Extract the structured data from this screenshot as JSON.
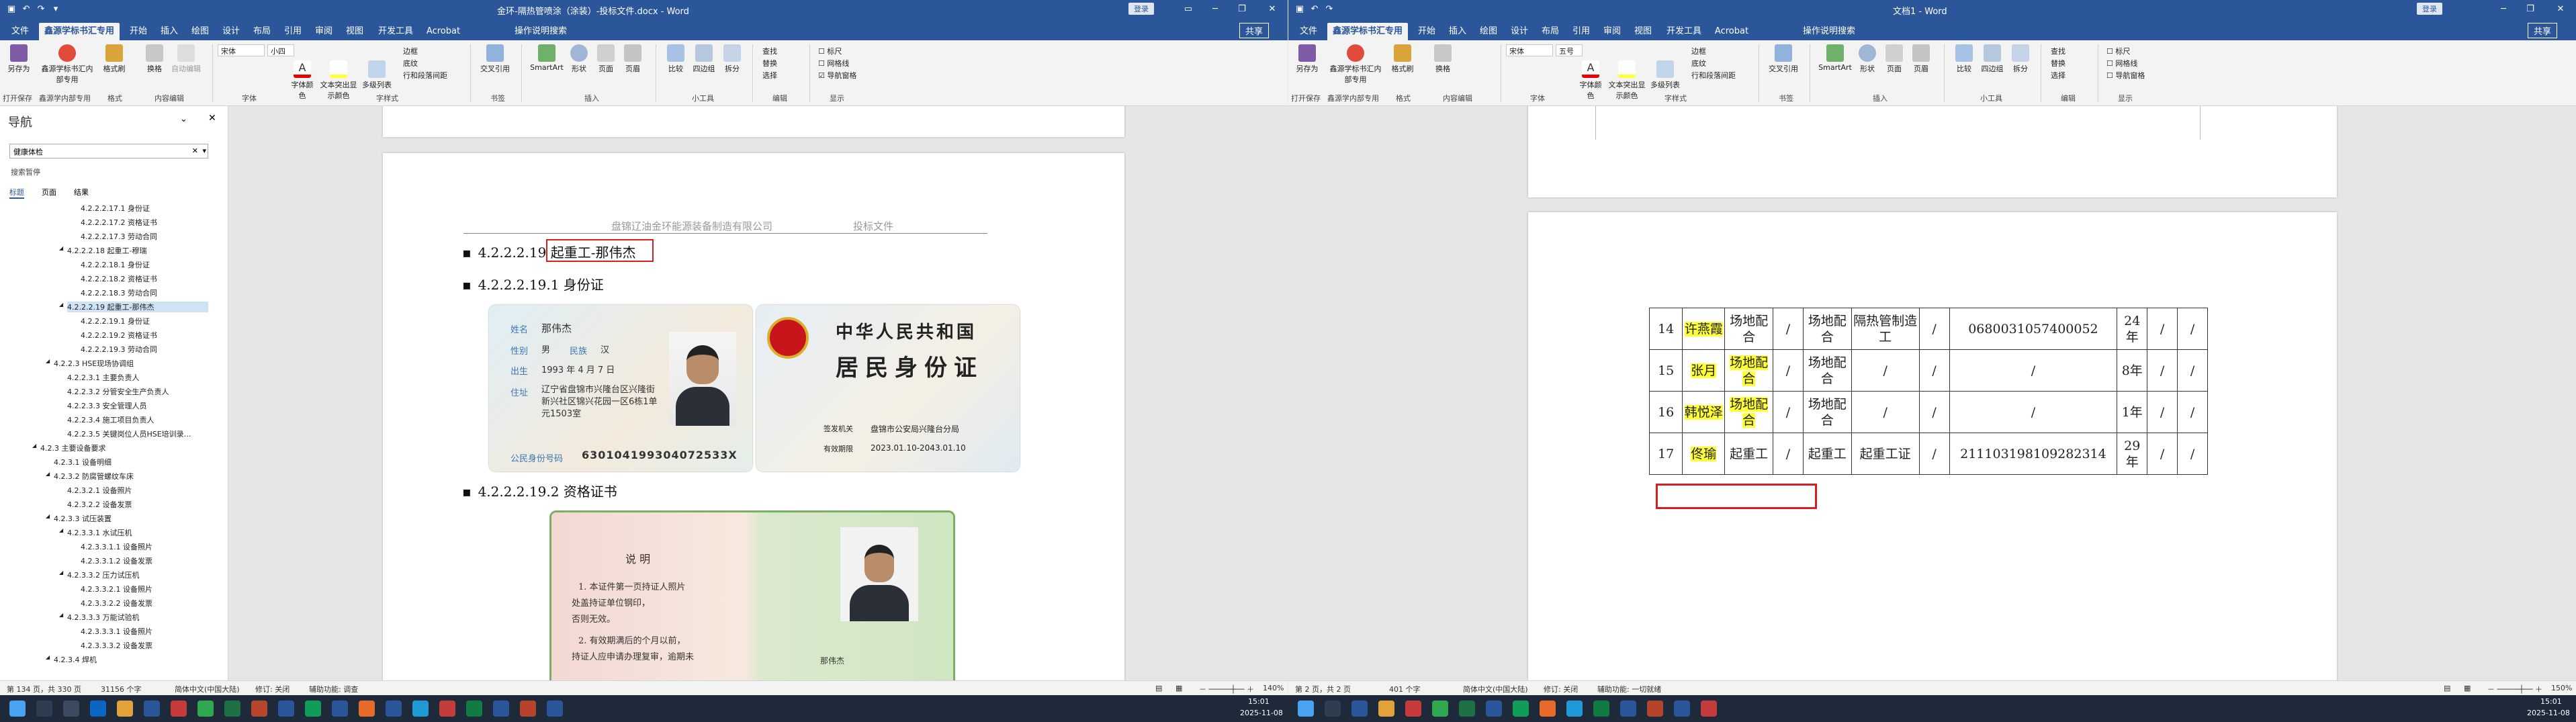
{
  "left": {
    "title": "金环-隔热管喷涂（涂装）-投标文件.docx - Word",
    "login": "登录",
    "share": "共享",
    "tabs": [
      "文件",
      "鑫源学标书汇专用",
      "开始",
      "插入",
      "绘图",
      "设计",
      "布局",
      "引用",
      "审阅",
      "视图",
      "开发工具",
      "Acrobat",
      "操作说明搜索"
    ],
    "ribbon": {
      "btn_save_as": "另存为",
      "btn_xyx": "鑫源学标书汇内部专用",
      "btn_format": "格式刷",
      "btn_change": "换格",
      "btn_auto": "自动编辑",
      "font_name": "宋体",
      "font_size": "小四",
      "btn_font_color": "字体颜色",
      "btn_text_color": "文本突出显示颜色",
      "btn_multi": "多级列表",
      "border": "边框",
      "shading": "底纹",
      "indent": "行和段落间距",
      "btn_cross": "交叉引用",
      "btn_smartart": "SmartArt",
      "btn_shape": "形状",
      "btn_page": "页面",
      "btn_header": "页眉",
      "btn_compare": "比较",
      "btn_four": "四边组",
      "btn_split": "拆分",
      "find": "查找",
      "replace": "替换",
      "select": "选择",
      "ruler": "标尺",
      "gridlines": "网格线",
      "navpane": "导航窗格",
      "groups": [
        "打开保存",
        "鑫源学内部专用",
        "格式",
        "内容编辑",
        "字体",
        "字样式",
        "书签",
        "插入",
        "小工具",
        "编辑",
        "显示"
      ]
    },
    "nav": {
      "title": "导航",
      "search": "健康体检",
      "results": "搜索暂停",
      "tabs": [
        "标题",
        "页面",
        "结果"
      ],
      "items": [
        "4.2.2.2.17.1 身份证",
        "4.2.2.2.17.2 资格证书",
        "4.2.2.2.17.3 劳动合同",
        "4.2.2.2.18 起重工-穆瑞",
        "4.2.2.2.18.1 身份证",
        "4.2.2.2.18.2 资格证书",
        "4.2.2.2.18.3 劳动合同",
        "4.2.2.2.19 起重工-那伟杰",
        "4.2.2.2.19.1 身份证",
        "4.2.2.2.19.2 资格证书",
        "4.2.2.2.19.3 劳动合同",
        "4.2.2.3 HSE现场协调组",
        "4.2.2.3.1 主要负责人",
        "4.2.2.3.2 分管安全生产负责人",
        "4.2.2.3.3 安全管理人员",
        "4.2.2.3.4 施工项目负责人",
        "4.2.2.3.5 关键岗位人员HSE培训录…",
        "4.2.3 主要设备要求",
        "4.2.3.1 设备明细",
        "4.2.3.2 防腐管螺纹车床",
        "4.2.3.2.1 设备照片",
        "4.2.3.2.2 设备发票",
        "4.2.3.3 试压装置",
        "4.2.3.3.1 水试压机",
        "4.2.3.3.1.1 设备照片",
        "4.2.3.3.1.2 设备发票",
        "4.2.3.3.2 压力试压机",
        "4.2.3.3.2.1 设备照片",
        "4.2.3.3.2.2 设备发票",
        "4.2.3.3.3 万能试验机",
        "4.2.3.3.3.1 设备照片",
        "4.2.3.3.3.2 设备发票",
        "4.2.3.4 焊机"
      ]
    },
    "doc": {
      "header_company": "盘锦辽油金环能源装备制造有限公司",
      "header_right": "投标文件",
      "h1": "4.2.2.2.19 起重工-那伟杰",
      "h2": "4.2.2.2.19.1 身份证",
      "h3": "4.2.2.2.19.2 资格证书",
      "id_front": {
        "name_label": "姓名",
        "name": "那伟杰",
        "sex_label": "性别",
        "sex": "男",
        "eth_label": "民族",
        "eth": "汉",
        "birth_label": "出生",
        "birth": "1993 年 4 月 7 日",
        "addr_label": "住址",
        "addr": "辽宁省盘锦市兴隆台区兴隆街新兴社区锦兴花园一区6栋1单元1503室",
        "id_label": "公民身份号码",
        "id": "630104199304072533X"
      },
      "id_back": {
        "title1": "中华人民共和国",
        "title2": "居民身份证",
        "authority_label": "签发机关",
        "authority": "盘锦市公安局兴隆台分局",
        "valid_label": "有效期限",
        "valid": "2023.01.10-2043.01.10"
      },
      "cert": {
        "heading": "说 明",
        "lines": [
          "1. 本证件第一页持证人照片",
          "处盖持证单位钢印，",
          "否则无效。",
          "2. 有效期满后的个月以前，",
          "持证人应申请办理复审，逾期未"
        ],
        "holder": "那伟杰"
      }
    },
    "status": {
      "page": "第 134 页，共 330 页",
      "words": "31156 个字",
      "lang": "简体中文(中国大陆)",
      "track": "修订: 关闭",
      "access": "辅助功能: 调查",
      "zoom": "140%"
    }
  },
  "right": {
    "title": "文档1 - Word",
    "login": "登录",
    "share": "共享",
    "tabs": [
      "文件",
      "鑫源学标书汇专用",
      "开始",
      "插入",
      "绘图",
      "设计",
      "布局",
      "引用",
      "审阅",
      "视图",
      "开发工具",
      "Acrobat",
      "操作说明搜索"
    ],
    "ribbon": {
      "font_name": "宋体",
      "font_size": "五号"
    },
    "table": [
      {
        "no": "14",
        "name": "许燕霞",
        "role": "场地配合",
        "x1": "/",
        "role2": "场地配合",
        "type": "隔热管制造工",
        "x2": "/",
        "id": "0680031057400052",
        "age": "24年",
        "x3": "/",
        "x4": "/"
      },
      {
        "no": "15",
        "name": "张月",
        "role": "场地配合",
        "x1": "/",
        "role2": "场地配合",
        "type": "/",
        "x2": "/",
        "id": "/",
        "age": "8年",
        "x3": "/",
        "x4": "/"
      },
      {
        "no": "16",
        "name": "韩悦泽",
        "role": "场地配合",
        "x1": "/",
        "role2": "场地配合",
        "type": "/",
        "x2": "/",
        "id": "/",
        "age": "1年",
        "x3": "/",
        "x4": "/"
      },
      {
        "no": "17",
        "name": "佟瑜",
        "role": "起重工",
        "x1": "/",
        "role2": "起重工",
        "type": "起重工证",
        "x2": "/",
        "id": "211103198109282314",
        "age": "29年",
        "x3": "/",
        "x4": "/"
      }
    ],
    "status": {
      "page": "第 2 页，共 2 页",
      "words": "401 个字",
      "lang": "简体中文(中国大陆)",
      "track": "修订: 关闭",
      "access": "辅助功能: 一切就绪",
      "zoom": "150%"
    }
  },
  "taskbar": {
    "time_left": "15:01",
    "date_left": "2025-11-08",
    "time_right": "15:01",
    "date_right": "2025-11-08"
  },
  "colors": {
    "word_blue": "#2b579a",
    "highlight": "#ffff33",
    "red_box": "#d42020"
  }
}
